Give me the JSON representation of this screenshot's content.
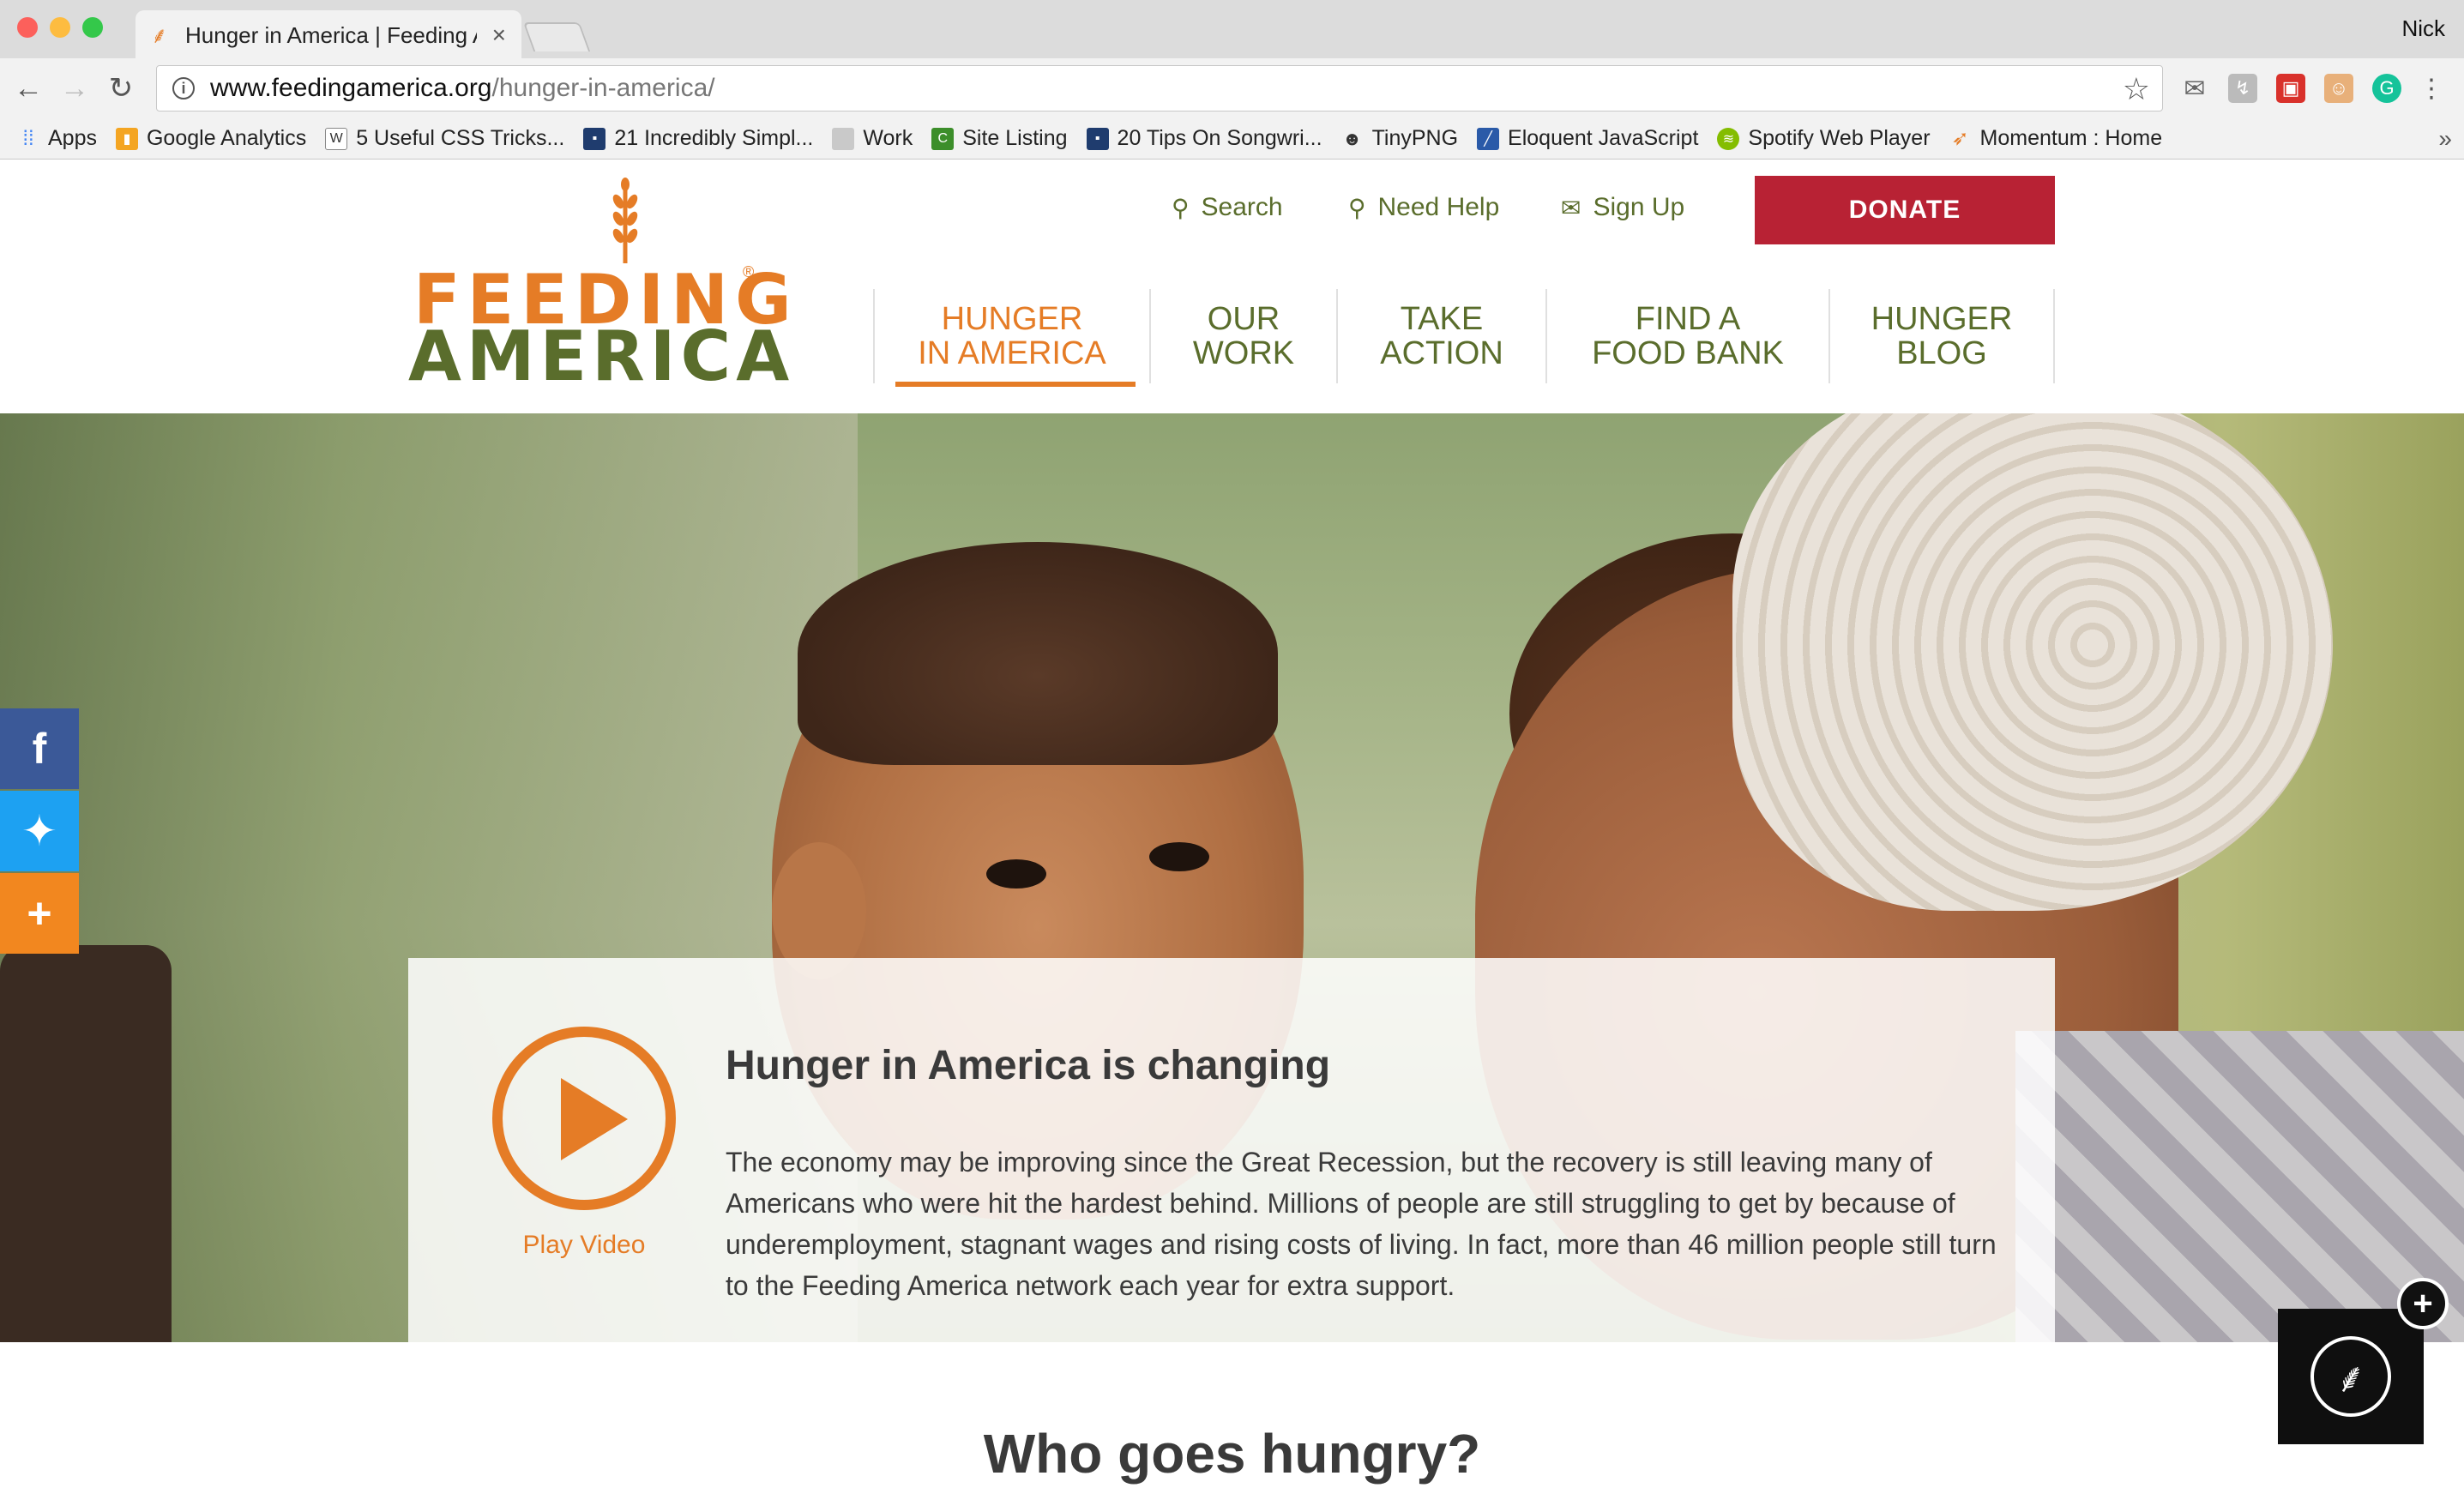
{
  "browser": {
    "tab_title": "Hunger in America | Feeding A",
    "profile_name": "Nick",
    "url_host": "www.feedingamerica.org",
    "url_path": "/hunger-in-america/",
    "bookmarks": [
      {
        "label": "Apps",
        "icon": "apps-grid-icon"
      },
      {
        "label": "Google Analytics",
        "icon": "analytics-icon"
      },
      {
        "label": "5 Useful CSS Tricks...",
        "icon": "w-icon"
      },
      {
        "label": "21 Incredibly Simpl...",
        "icon": "site-icon"
      },
      {
        "label": "Work",
        "icon": "folder-icon"
      },
      {
        "label": "Site Listing",
        "icon": "site-listing-icon"
      },
      {
        "label": "20 Tips On Songwri...",
        "icon": "site-icon"
      },
      {
        "label": "TinyPNG",
        "icon": "panda-icon"
      },
      {
        "label": "Eloquent JavaScript",
        "icon": "book-icon"
      },
      {
        "label": "Spotify Web Player",
        "icon": "spotify-icon"
      },
      {
        "label": "Momentum : Home",
        "icon": "rocket-icon"
      }
    ]
  },
  "header": {
    "logo_line1": "FEEDING",
    "logo_line2": "AMERICA",
    "utility": {
      "search": "Search",
      "need_help": "Need Help",
      "sign_up": "Sign Up"
    },
    "donate": "DONATE",
    "nav": [
      {
        "label": "HUNGER\nIN AMERICA",
        "active": true
      },
      {
        "label": "OUR\nWORK",
        "active": false
      },
      {
        "label": "TAKE\nACTION",
        "active": false
      },
      {
        "label": "FIND A\nFOOD BANK",
        "active": false
      },
      {
        "label": "HUNGER\nBLOG",
        "active": false
      }
    ]
  },
  "hero": {
    "card_title": "Hunger in America is changing",
    "card_body": "The economy may be improving since the Great Recession, but the recovery is still leaving many of Americans who were hit the hardest behind. Millions of people are still struggling to get by because of underemployment, stagnant wages and rising costs of living. In fact, more than 46 million people still turn to the Feeding America network each year for extra support.",
    "play_label": "Play Video"
  },
  "section": {
    "title": "Who goes hungry?"
  },
  "colors": {
    "brand_orange": "#e57c26",
    "brand_green": "#5a6d2c",
    "donate_red": "#b82234",
    "facebook": "#3b5998",
    "twitter": "#1da1f2",
    "share_more": "#f2871f"
  }
}
